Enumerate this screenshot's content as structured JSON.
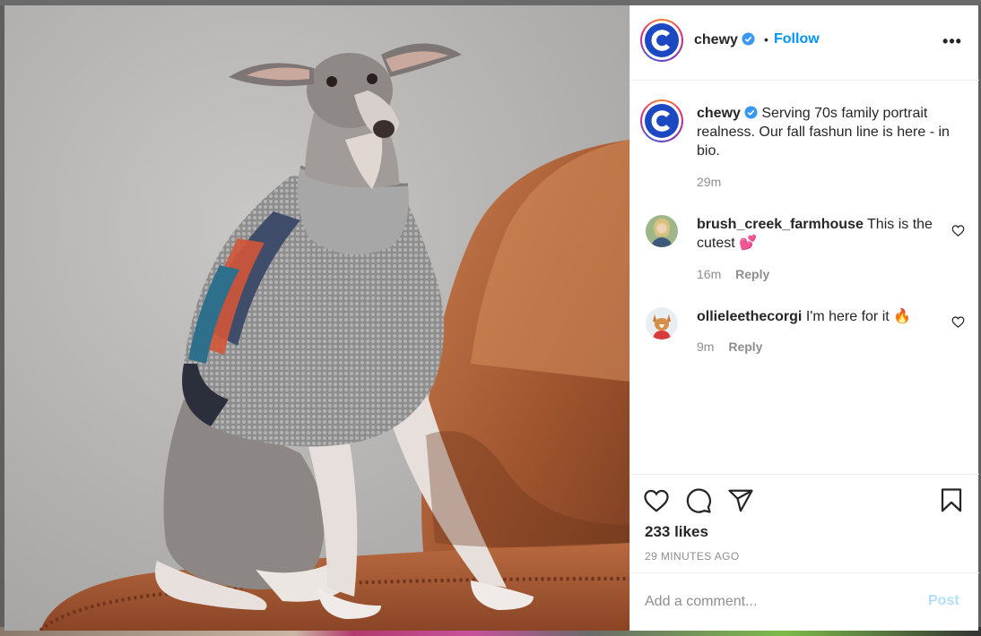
{
  "post": {
    "author": "chewy",
    "verified": true,
    "follow_label": "Follow",
    "dot": "•",
    "more_label": "•••",
    "image_alt": "Italian greyhound wearing a knit sweater sitting on a leather chair",
    "caption_text": "Serving 70s family portrait realness. Our fall fashun line is here - in bio.",
    "caption_time": "29m",
    "likes": "233 likes",
    "posted": "29 MINUTES AGO"
  },
  "comments": [
    {
      "username": "brush_creek_farmhouse",
      "text": "This is the cutest 💕",
      "time": "16m",
      "reply_label": "Reply"
    },
    {
      "username": "ollieleethecorgi",
      "text": "I'm here for it 🔥",
      "time": "9m",
      "reply_label": "Reply"
    }
  ],
  "composer": {
    "placeholder": "Add a comment...",
    "post_label": "Post"
  },
  "colors": {
    "link_blue": "#0095f6",
    "post_disabled": "#b2dffc",
    "muted": "#8e8e8e",
    "brand_blue": "#1c49c2"
  },
  "icons": [
    "heart-icon",
    "comment-icon",
    "share-icon",
    "bookmark-icon",
    "verified-badge-icon",
    "more-icon"
  ]
}
